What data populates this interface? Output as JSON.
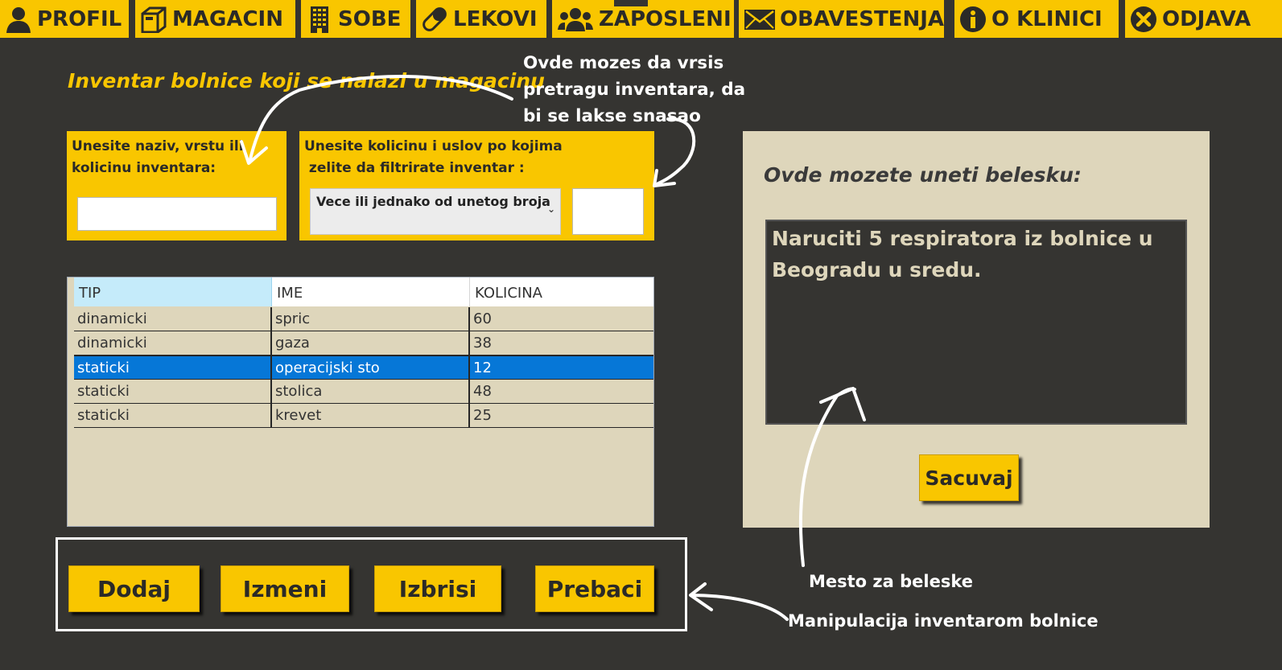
{
  "nav": {
    "items": [
      {
        "label": "PROFIL",
        "icon": "user-icon"
      },
      {
        "label": "MAGACIN",
        "icon": "box-icon"
      },
      {
        "label": "SOBE",
        "icon": "building-icon"
      },
      {
        "label": "LEKOVI",
        "icon": "pill-icon"
      },
      {
        "label": "ZAPOSLENI",
        "icon": "users-icon"
      },
      {
        "label": "OBAVESTENJA",
        "icon": "mail-icon"
      },
      {
        "label": "O KLINICI",
        "icon": "info-icon"
      },
      {
        "label": "ODJAVA",
        "icon": "close-circle-icon"
      }
    ]
  },
  "inventory": {
    "heading": "Inventar bolnice koji se nalazi u magacinu",
    "search": {
      "label": "Unesite naziv, vrstu ili kolicinu inventara:",
      "value": ""
    },
    "filter": {
      "label_line1": "Unesite kolicinu i uslov po kojima",
      "label_line2": " zelite da filtrirate inventar :",
      "condition": "Vece ili jednako od unetog broja",
      "amount": ""
    },
    "table": {
      "columns": [
        "TIP",
        "IME",
        "KOLICINA"
      ],
      "rows": [
        {
          "tip": "dinamicki",
          "ime": "spric",
          "kolicina": "60"
        },
        {
          "tip": "dinamicki",
          "ime": "gaza",
          "kolicina": "38"
        },
        {
          "tip": "staticki",
          "ime": "operacijski sto",
          "kolicina": "12"
        },
        {
          "tip": "staticki",
          "ime": "stolica",
          "kolicina": "48"
        },
        {
          "tip": "staticki",
          "ime": "krevet",
          "kolicina": "25"
        }
      ],
      "selected_row": 2
    },
    "actions": {
      "add": "Dodaj",
      "edit": "Izmeni",
      "delete": "Izbrisi",
      "move": "Prebaci"
    }
  },
  "notes": {
    "title": "Ovde mozete uneti belesku:",
    "text": "Naruciti 5 respiratora iz bolnice u Beogradu u sredu.",
    "save": "Sacuvaj"
  },
  "annotations": {
    "search_hint": "Ovde mozes da vrsis pretragu inventara, da bi se lakse snasao",
    "notes_hint": "Mesto za beleske",
    "manip_hint": "Manipulacija inventarom bolnice"
  },
  "colors": {
    "accent": "#f9c600",
    "background": "#353431",
    "panel": "#ded6bb",
    "selection": "#0677d7"
  }
}
